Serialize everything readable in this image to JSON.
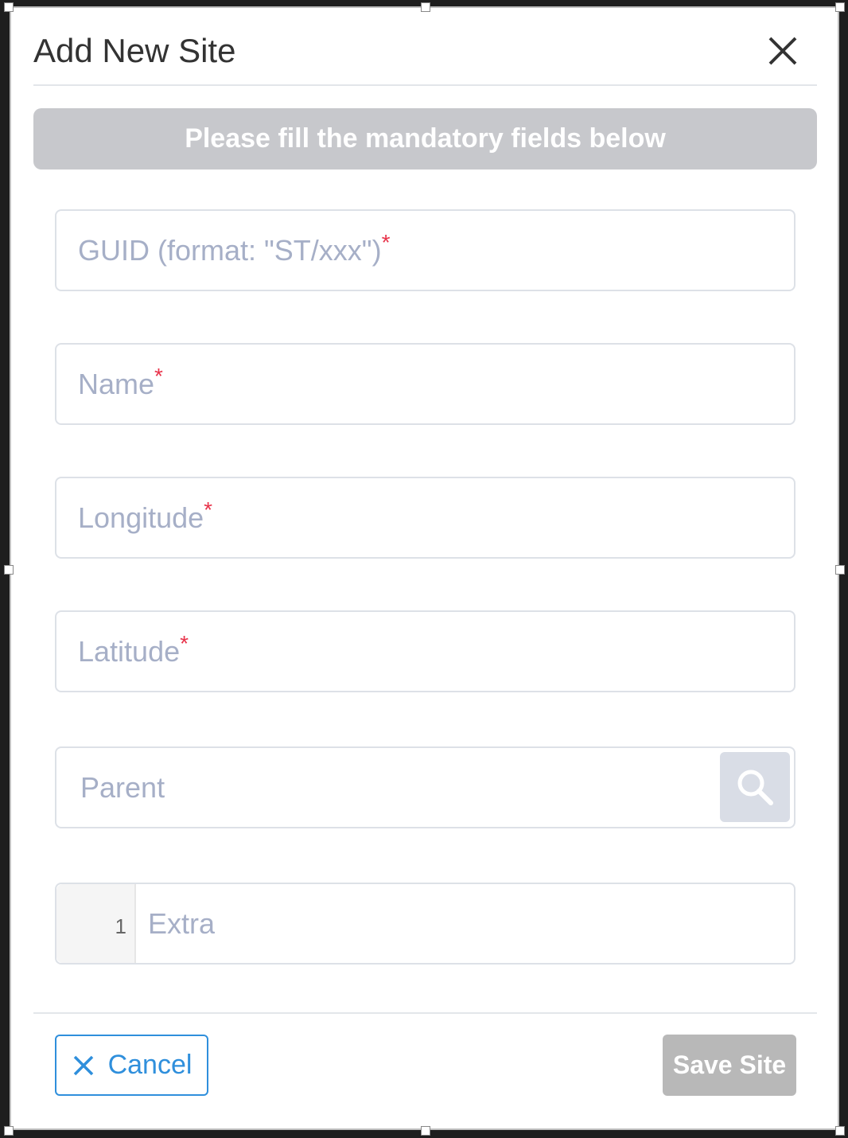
{
  "dialog": {
    "title": "Add New Site"
  },
  "banner": {
    "text": "Please fill the mandatory fields below"
  },
  "fields": {
    "guid": {
      "placeholder": "GUID (format: \"ST/xxx\")",
      "required_mark": "*"
    },
    "name": {
      "placeholder": "Name",
      "required_mark": "*"
    },
    "longitude": {
      "placeholder": "Longitude",
      "required_mark": "*"
    },
    "latitude": {
      "placeholder": "Latitude",
      "required_mark": "*"
    },
    "parent": {
      "placeholder": "Parent",
      "button_icon": "search-icon"
    },
    "extra": {
      "line_number": "1",
      "placeholder": "Extra"
    }
  },
  "footer": {
    "cancel_label": "Cancel",
    "save_label": "Save Site"
  },
  "colors": {
    "accent": "#2f8fdc",
    "required": "#e8334a",
    "banner_bg": "#c7c8cc",
    "save_disabled_bg": "#b8b8b8"
  }
}
